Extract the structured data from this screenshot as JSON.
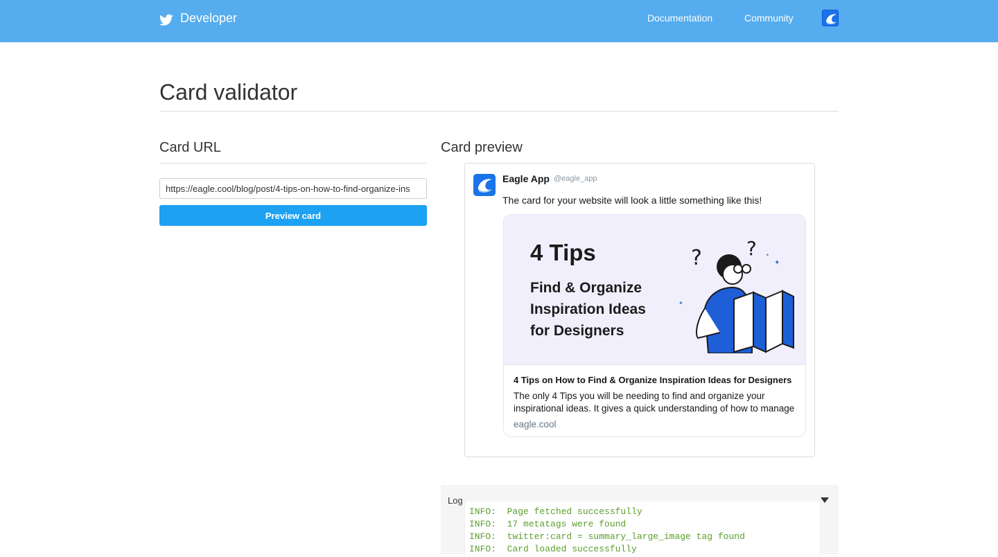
{
  "nav": {
    "brand": "Developer",
    "links": [
      "Documentation",
      "Community"
    ]
  },
  "page": {
    "title": "Card validator"
  },
  "url_section": {
    "heading": "Card URL",
    "url_value": "https://eagle.cool/blog/post/4-tips-on-how-to-find-organize-ins",
    "button_label": "Preview card"
  },
  "preview_section": {
    "heading": "Card preview",
    "tweet": {
      "name": "Eagle App",
      "handle": "@eagle_app",
      "text": "The card for your website will look a little something like this!"
    },
    "card": {
      "image_heading": "4 Tips",
      "image_lines": [
        "Find & Organize",
        "Inspiration Ideas",
        "for Designers"
      ],
      "title": "4 Tips on How to Find & Organize Inspiration Ideas for Designers",
      "description_lines": [
        "The only 4 Tips you will be needing to find and organize your",
        "inspirational ideas. It gives a quick understanding of how to manage"
      ],
      "domain": "eagle.cool"
    }
  },
  "log": {
    "label": "Log",
    "lines": [
      "INFO:  Page fetched successfully",
      "INFO:  17 metatags were found",
      "INFO:  twitter:card = summary_large_image tag found",
      "INFO:  Card loaded successfully"
    ]
  },
  "icons": {
    "brand": "twitter-bird-icon",
    "avatar": "eagle-logo-icon",
    "toggle": "caret-down-icon"
  },
  "colors": {
    "topbar": "#55acee",
    "button": "#1da1f2",
    "log_text": "#5aa02c"
  }
}
